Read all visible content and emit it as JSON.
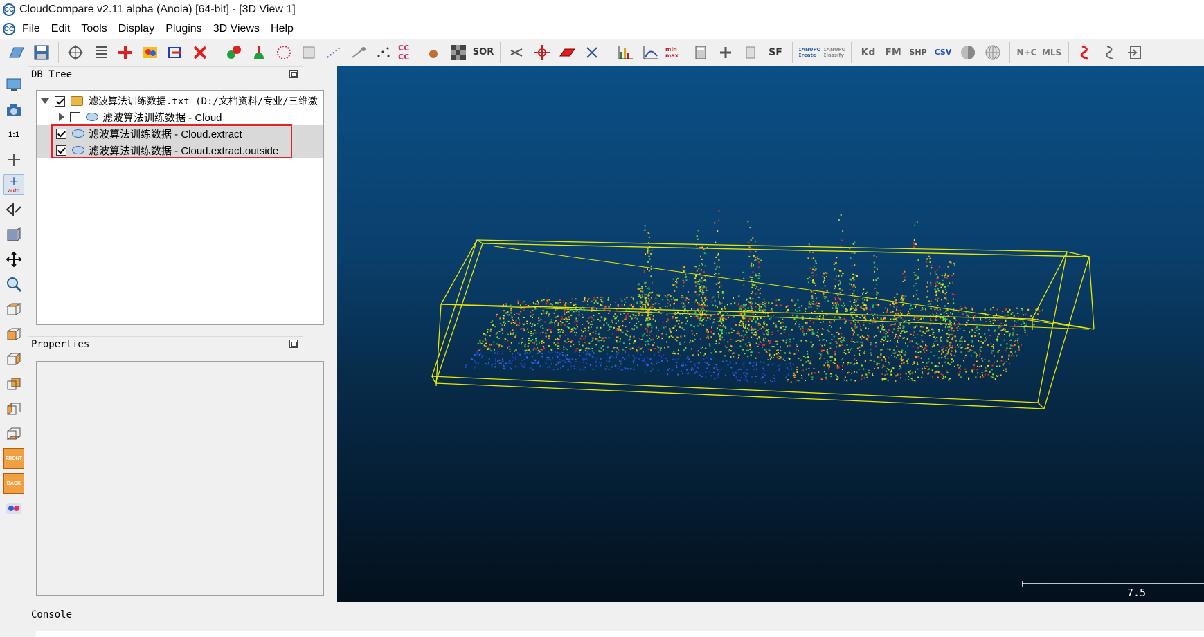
{
  "window": {
    "title": "CloudCompare v2.11 alpha (Anoia) [64-bit] - [3D View 1]",
    "logo_text": "CC"
  },
  "menu": [
    {
      "label": "File",
      "accel": "F",
      "rest": "ile"
    },
    {
      "label": "Edit",
      "accel": "E",
      "rest": "dit"
    },
    {
      "label": "Tools",
      "accel": "T",
      "rest": "ools"
    },
    {
      "label": "Display",
      "accel": "D",
      "rest": "isplay"
    },
    {
      "label": "Plugins",
      "accel": "P",
      "rest": "lugins"
    },
    {
      "label": "3D Views",
      "accel": "V",
      "pre": "3D ",
      "rest": "iews"
    },
    {
      "label": "Help",
      "accel": "H",
      "rest": "elp"
    }
  ],
  "toolbar": {
    "sor_label": "SOR",
    "sf_label": "SF",
    "kd_label": "Kd",
    "fm_label": "FM",
    "shp_label": "SHP",
    "csv_label": "CSV",
    "nc_label": "N+C",
    "mls_label": "MLS",
    "canupo_create": "CANUPO Create",
    "canupo_classify": "CANUPO Classify",
    "min_max": "min max",
    "cc_label": "CC CC"
  },
  "vtoolbar": {
    "one_to_one": "1:1",
    "auto": "auto",
    "front": "FRONT",
    "back": "BACK"
  },
  "db_tree": {
    "header": "DB Tree",
    "items": [
      {
        "text": "滤波算法训练数据.txt (D:/文档资料/专业/三维激",
        "checked": true,
        "expanded": true,
        "selected": false
      },
      {
        "text": "滤波算法训练数据 - Cloud",
        "checked": false,
        "expanded": false,
        "selected": false
      },
      {
        "text": "滤波算法训练数据 - Cloud.extract",
        "checked": true,
        "selected": true
      },
      {
        "text": "滤波算法训练数据 - Cloud.extract.outside",
        "checked": true,
        "selected": true
      }
    ]
  },
  "properties": {
    "header": "Properties"
  },
  "console": {
    "header": "Console"
  },
  "view3d": {
    "scale_label": "7.5",
    "box_color": "#e8e800",
    "bg_top": "#0a4f86",
    "bg_bottom": "#03101c"
  }
}
